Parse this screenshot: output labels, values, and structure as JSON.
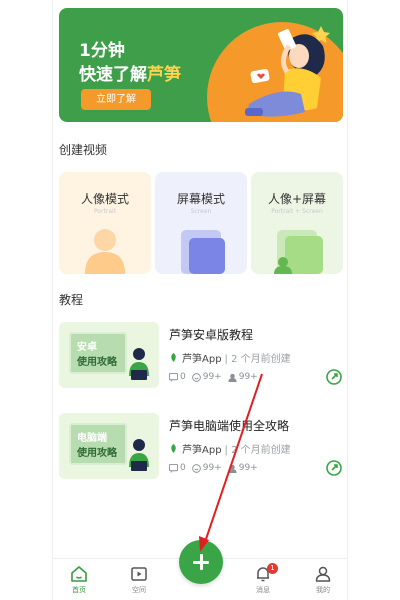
{
  "banner": {
    "line1": "1分钟",
    "line2_prefix": "快速了解",
    "line2_highlight": "芦笋",
    "button_label": "立即了解"
  },
  "create_section": {
    "title": "创建视频",
    "cards": [
      {
        "title": "人像模式",
        "subtitle": "Portrait"
      },
      {
        "title": "屏幕模式",
        "subtitle": "Screen"
      },
      {
        "title": "人像+屏幕",
        "subtitle": "Portrait + Screen"
      }
    ]
  },
  "tutorial_section": {
    "title": "教程",
    "items": [
      {
        "thumb_line1": "安卓",
        "thumb_line2": "使用攻略",
        "title": "芦笋安卓版教程",
        "author": "芦笋App",
        "meta": "| 2 个月前创建",
        "comments": "0",
        "likes": "99+",
        "views": "99+"
      },
      {
        "thumb_line1": "电脑端",
        "thumb_line2": "使用攻略",
        "title": "芦笋电脑端使用全攻略",
        "author": "芦笋App",
        "meta": "| 2 个月前创建",
        "comments": "0",
        "likes": "99+",
        "views": "99+"
      }
    ]
  },
  "bottom_nav": {
    "items": [
      {
        "label": "首页",
        "icon": "home-icon"
      },
      {
        "label": "空间",
        "icon": "video-space-icon"
      },
      {
        "label": "消息",
        "icon": "bell-icon",
        "badge": "1"
      },
      {
        "label": "我的",
        "icon": "person-icon"
      }
    ],
    "fab_icon": "plus-icon"
  },
  "colors": {
    "brand_green": "#3aa546",
    "banner_orange": "#f59a2a",
    "annotation_red": "#e02020"
  }
}
